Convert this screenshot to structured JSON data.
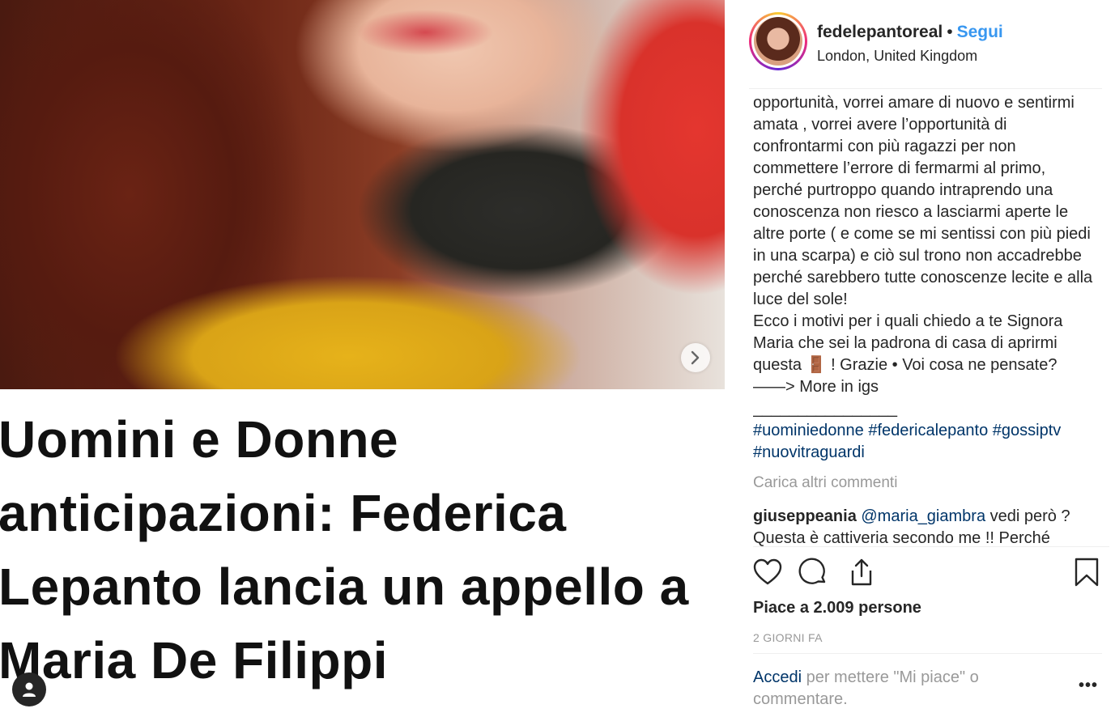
{
  "post": {
    "headline": "Uomini e Donne anticipazioni: Federica Lepanto lancia un appello a Maria De Filippi",
    "next_icon": "chevron-right-icon"
  },
  "header": {
    "username": "fedelepantoreal",
    "separator": "•",
    "follow_label": "Segui",
    "location": "London, United Kingdom"
  },
  "caption": {
    "text": "opportunità, vorrei amare di nuovo e sentirmi amata , vorrei avere l’opportunità di confrontarmi con più ragazzi per non commettere l’errore di fermarmi al primo, perché purtroppo quando intraprendo una conoscenza non riesco a lasciarmi aperte le altre porte ( e come se mi sentissi con più piedi in una scarpa) e ciò sul trono non accadrebbe perché sarebbero tutte conoscenze lecite e alla luce del sole!\nEcco i motivi per i quali chiedo a te Signora Maria che sei la padrona di casa di aprirmi questa 🚪 ! Grazie • Voi cosa ne pensate?\n——> More in igs\n________________",
    "hashtags": "#uominiedonne #federicalepanto #gossiptv #nuovitraguardi"
  },
  "load_more": "Carica altri commenti",
  "comment": {
    "user": "giuseppeania",
    "mention": "@maria_giambra",
    "text": " vedi però ? Questa è cattiveria secondo me !! Perché"
  },
  "likes": "Piace a 2.009 persone",
  "time_ago": "2 GIORNI FA",
  "login": {
    "link": "Accedi",
    "text": " per mettere \"Mi piace\" o commentare."
  },
  "more_label": "•••",
  "colors": {
    "link": "#003569",
    "follow": "#3897f0",
    "muted": "#999999",
    "text": "#262626"
  }
}
